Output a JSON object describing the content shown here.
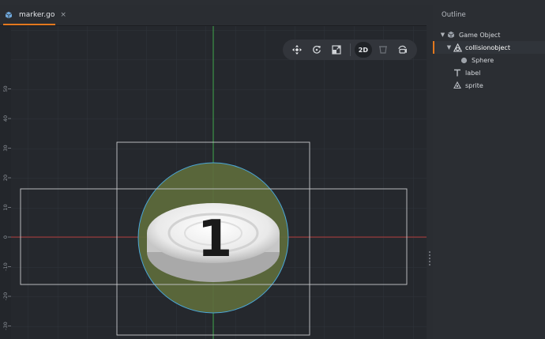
{
  "tab": {
    "file_name": "marker.go",
    "close_glyph": "×"
  },
  "toolbar": {
    "mode_2d_label": "2D",
    "icons": [
      "move-icon",
      "rotate-icon",
      "scale-icon",
      "visibility-icon",
      "camera-icon"
    ]
  },
  "viewport": {
    "ruler_labels": [
      "50",
      "40",
      "30",
      "20",
      "10",
      "0",
      "-10",
      "-20",
      "-30"
    ],
    "sprite_text": "1",
    "colors": {
      "x_axis": "#b03a3a",
      "y_axis": "#3fa84a",
      "collision": "#5d6b3c",
      "collision_edge": "#4aa6d8"
    }
  },
  "outline": {
    "title": "Outline",
    "items": [
      {
        "label": "Game Object",
        "icon": "game-object-icon",
        "expanded": true
      },
      {
        "label": "collisionobject",
        "icon": "collision-object-icon",
        "expanded": true,
        "selected": true
      },
      {
        "label": "Sphere",
        "icon": "sphere-icon"
      },
      {
        "label": "label",
        "icon": "text-label-icon"
      },
      {
        "label": "sprite",
        "icon": "sprite-icon"
      }
    ]
  },
  "colors": {
    "accent": "#e3781e",
    "background": "#22252a",
    "panel": "#2b2e33"
  }
}
